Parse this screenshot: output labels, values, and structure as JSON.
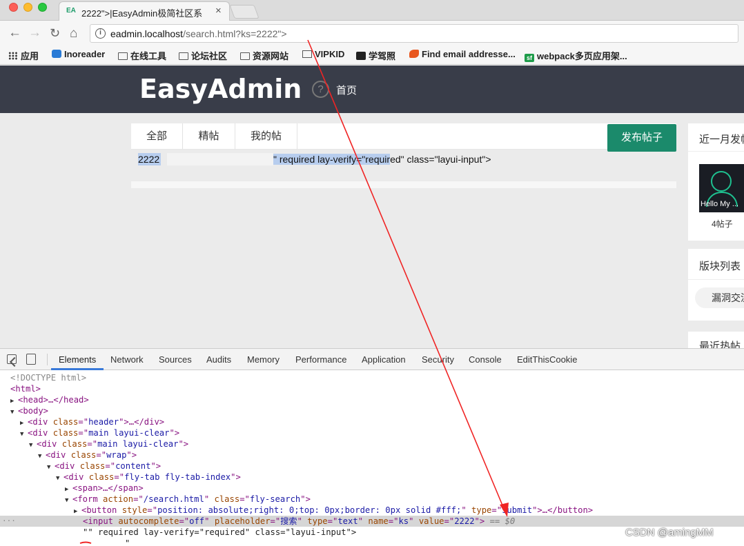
{
  "browser": {
    "tab_title": "2222\">|EasyAdmin极简社区系",
    "tab_favicon": "EA",
    "tab_close": "×",
    "url_host": "eadmin.localhost",
    "url_path": "/search.html?ks=2222\">",
    "bookmarks": [
      {
        "icon": "apps-icon",
        "label": "应用"
      },
      {
        "icon": "inoreader-icon",
        "label": "Inoreader"
      },
      {
        "icon": "folder-icon",
        "label": "在线工具"
      },
      {
        "icon": "folder-icon",
        "label": "论坛社区"
      },
      {
        "icon": "folder-icon",
        "label": "资源网站"
      },
      {
        "icon": "folder-icon",
        "label": "VIPKID"
      },
      {
        "icon": "xuejiapeng-icon",
        "label": "学驾照"
      },
      {
        "icon": "find-email-icon",
        "label": "Find email addresse..."
      },
      {
        "icon": "sf-icon",
        "label": "webpack多页应用架..."
      }
    ]
  },
  "site": {
    "logo": "EasyAdmin",
    "nav_home": "首页",
    "tabs": [
      "全部",
      "精帖",
      "我的帖"
    ],
    "search_value": "2222",
    "leaked_selected": "\" required lay-verify=\"requir",
    "leaked_rest": "ed\" class=\"layui-input\">",
    "post_button": "发布帖子",
    "sidebar": {
      "month_title": "近一月发帖",
      "avatar_caption": "Hello My ...",
      "post_count": "4帖子",
      "boards_title": "版块列表",
      "board_item": "漏洞交流",
      "hot_title": "最近热帖"
    }
  },
  "devtools": {
    "tabs": [
      "Elements",
      "Network",
      "Sources",
      "Audits",
      "Memory",
      "Performance",
      "Application",
      "Security",
      "Console",
      "EditThisCookie"
    ],
    "active_tab": "Elements",
    "dom": {
      "doctype": "<!DOCTYPE html>",
      "html": "<html>",
      "head": "<head>…</head>",
      "body": "<body>",
      "header_div": "header",
      "main_div": "main layui-clear",
      "wrap_div": "wrap",
      "content_div": "content",
      "tab_div": "fly-tab fly-tab-index",
      "span_line": "<span>…</span>",
      "form_action": "/search.html",
      "form_class": "fly-search",
      "button_style": "position: absolute;right: 0;top: 0px;border: 0px solid #fff;",
      "button_type": "submit",
      "input_autocomplete": "off",
      "input_placeholder": "搜索",
      "input_type": "text",
      "input_name": "ks",
      "input_value": "2222",
      "selected_marker": "== $0",
      "text_node_open": "\"\" required lay-verify=\"required\" class=\"layui-input\">",
      "text_node_close": "\""
    }
  },
  "watermark": "CSDN @amingMM",
  "colors": {
    "header_bg": "#393d49",
    "accent_green": "#1b8a6b",
    "selection": "#b7cdee",
    "arrow": "#f02424"
  }
}
